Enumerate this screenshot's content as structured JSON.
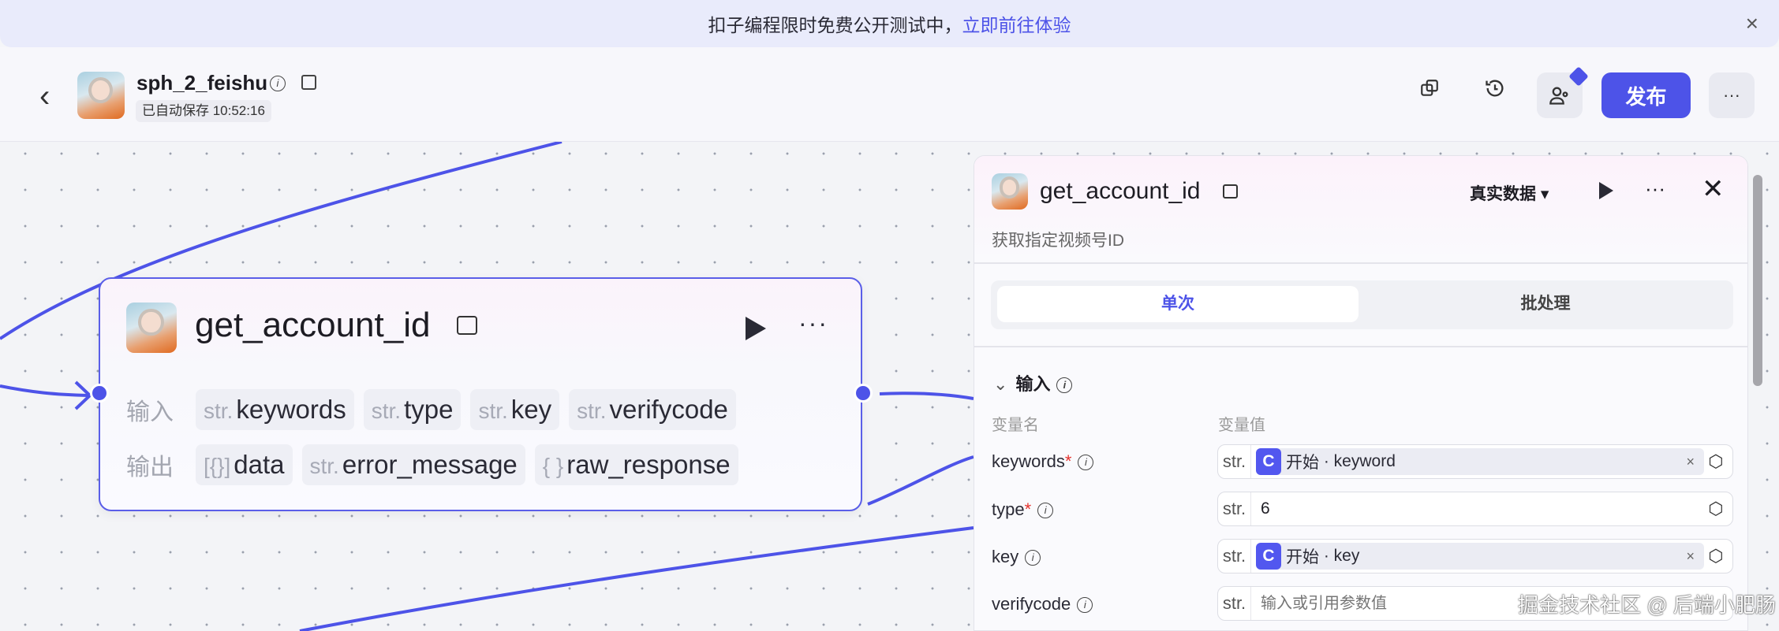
{
  "banner": {
    "text": "扣子编程限时免费公开测试中，",
    "link": "立即前往体验",
    "close": "×"
  },
  "header": {
    "title": "sph_2_feishu",
    "autosave": "已自动保存 10:52:16",
    "publish": "发布",
    "more": "···",
    "back": "‹"
  },
  "node": {
    "title": "get_account_id",
    "input_label": "输入",
    "output_label": "输出",
    "inputs": [
      {
        "type": "str.",
        "name": "keywords"
      },
      {
        "type": "str.",
        "name": "type"
      },
      {
        "type": "str.",
        "name": "key"
      },
      {
        "type": "str.",
        "name": "verifycode"
      }
    ],
    "outputs": [
      {
        "type": "[{}]",
        "name": "data"
      },
      {
        "type": "str.",
        "name": "error_message"
      },
      {
        "type": "{ }",
        "name": "raw_response"
      }
    ]
  },
  "panel": {
    "title": "get_account_id",
    "description": "获取指定视频号ID",
    "data_mode": "真实数据",
    "tabs": [
      {
        "label": "单次"
      },
      {
        "label": "批处理"
      }
    ],
    "section": "输入",
    "col_name": "变量名",
    "col_value": "变量值",
    "rows": [
      {
        "name": "keywords",
        "required": "*",
        "type": "str.",
        "ref_node": "开始",
        "ref_var": "keyword",
        "value": ""
      },
      {
        "name": "type",
        "required": "*",
        "type": "str.",
        "value": "6"
      },
      {
        "name": "key",
        "required": "",
        "type": "str.",
        "ref_node": "开始",
        "ref_var": "key",
        "value": ""
      },
      {
        "name": "verifycode",
        "required": "",
        "type": "str.",
        "placeholder": "输入或引用参数值",
        "value": ""
      }
    ]
  },
  "watermark": "掘金技术社区 @ 后端小肥肠",
  "colors": {
    "accent": "#4d53e8"
  }
}
